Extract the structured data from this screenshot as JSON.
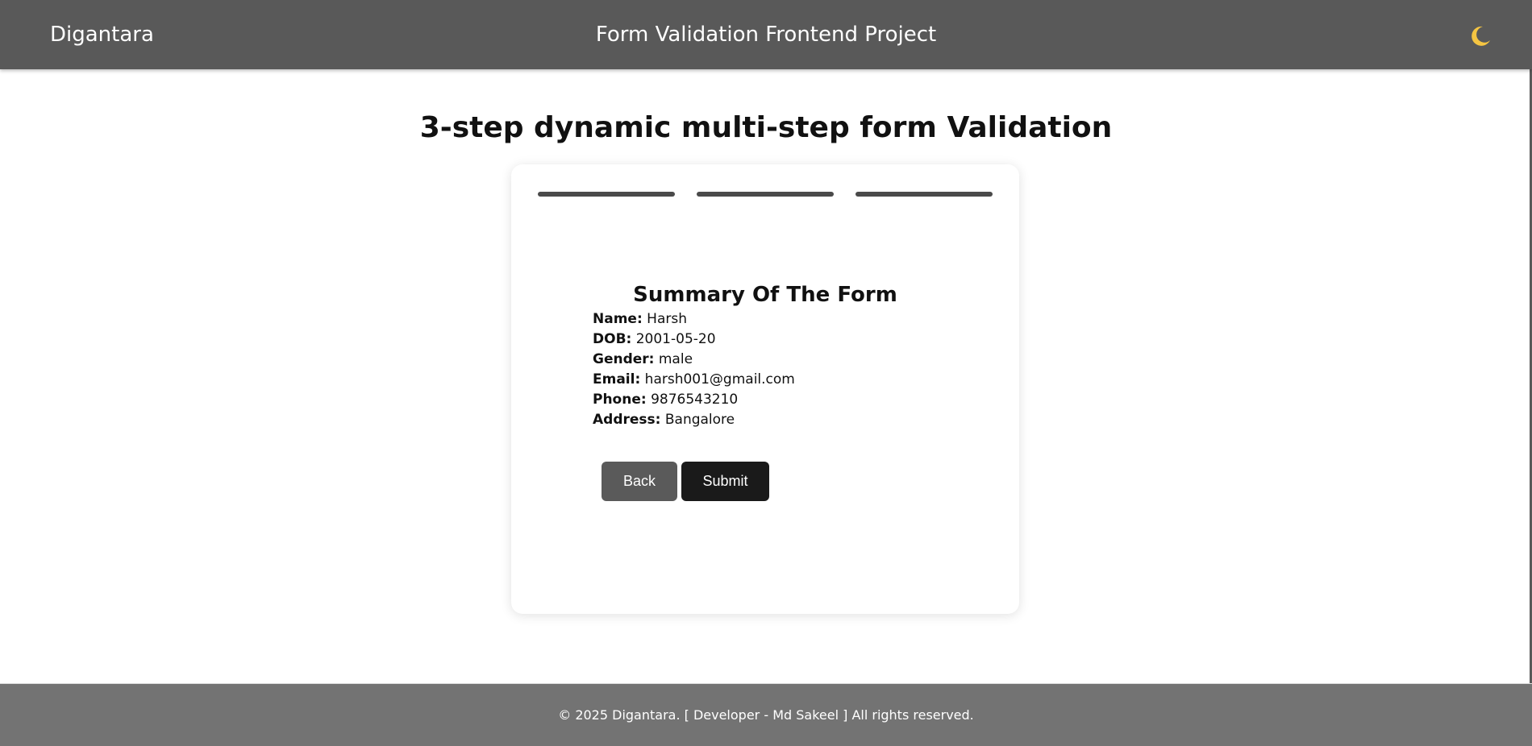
{
  "navbar": {
    "brand": "Digantara",
    "title": "Form Validation Frontend Project",
    "theme_icon": "moon-icon",
    "theme_icon_color": "#f5c542",
    "background": "#595959"
  },
  "page": {
    "heading": "3-step dynamic multi-step form Validation"
  },
  "form": {
    "steps_total": 3,
    "steps_completed": 3,
    "summary": {
      "title": "Summary Of The Form",
      "fields": [
        {
          "label": "Name:",
          "value": "Harsh"
        },
        {
          "label": "DOB:",
          "value": "2001-05-20"
        },
        {
          "label": "Gender:",
          "value": "male"
        },
        {
          "label": "Email:",
          "value": "harsh001@gmail.com"
        },
        {
          "label": "Phone:",
          "value": "9876543210"
        },
        {
          "label": "Address:",
          "value": "Bangalore"
        }
      ]
    },
    "buttons": {
      "back_label": "Back",
      "submit_label": "Submit"
    }
  },
  "footer": {
    "text": "© 2025 Digantara. [ Developer - Md Sakeel ] All rights reserved.",
    "background": "#737373"
  }
}
